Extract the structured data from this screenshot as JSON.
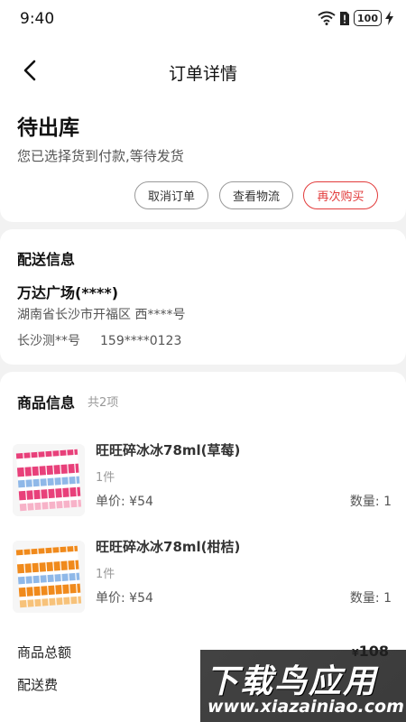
{
  "status_bar": {
    "time": "9:40",
    "battery": "100"
  },
  "nav": {
    "title": "订单详情"
  },
  "order": {
    "status": "待出库",
    "desc": "您已选择货到付款,等待发货",
    "buttons": {
      "cancel": "取消订单",
      "track": "查看物流",
      "rebuy": "再次购买"
    }
  },
  "shipping": {
    "title": "配送信息",
    "name": "万达广场(****)",
    "address": "湖南省长沙市开福区 西****号",
    "receiver": "长沙测**号",
    "phone": "159****0123"
  },
  "goods": {
    "title": "商品信息",
    "count": "共2项",
    "items": [
      {
        "name": "旺旺碎冰冰78ml(草莓)",
        "qty_text": "1件",
        "price": "单价: ¥54",
        "qty": "数量: 1",
        "flavor_color": "#e8407a"
      },
      {
        "name": "旺旺碎冰冰78ml(柑桔)",
        "qty_text": "1件",
        "price": "单价: ¥54",
        "qty": "数量: 1",
        "flavor_color": "#f08a1c"
      }
    ]
  },
  "summary": {
    "total_label": "商品总额",
    "total_currency": "¥",
    "total_value": "108",
    "shipping_fee_label": "配送费"
  },
  "watermark": {
    "text": "下载鸟应用",
    "url": "www.xiazainiao.com"
  },
  "colors": {
    "accent": "#e23b3b",
    "background": "#f2f2f2"
  }
}
